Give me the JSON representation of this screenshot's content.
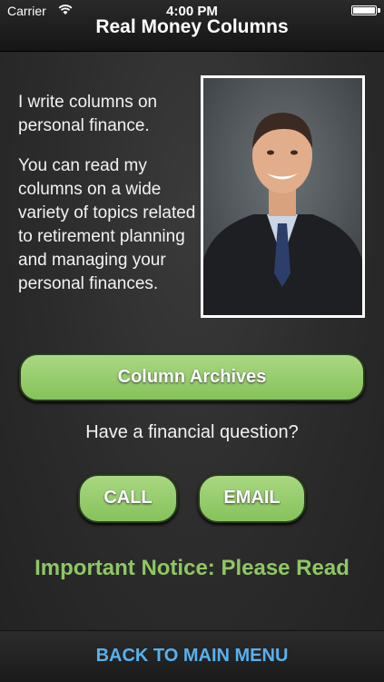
{
  "status_bar": {
    "carrier": "Carrier",
    "time": "4:00 PM"
  },
  "header": {
    "title": "Real Money Columns"
  },
  "intro": {
    "line1": "I write columns on personal finance.",
    "line2": "You can read my columns on a wide variety of topics related to retirement planning and managing your personal finances."
  },
  "buttons": {
    "archives": "Column Archives",
    "call": "CALL",
    "email": "EMAIL"
  },
  "question": "Have a financial question?",
  "notice": "Important Notice: Please Read",
  "footer": {
    "back": "BACK TO MAIN MENU"
  },
  "colors": {
    "accent_green": "#8fc763",
    "button_green": "#9ccf74",
    "link_blue": "#5ab0ea"
  },
  "icons": {
    "wifi": "wifi-icon",
    "battery": "battery-icon"
  }
}
